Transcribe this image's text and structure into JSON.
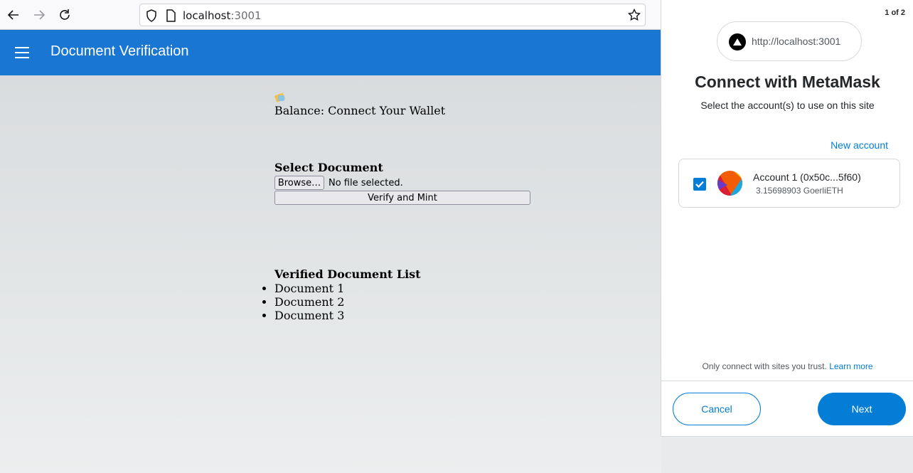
{
  "browser": {
    "url_host": "localhost",
    "url_port": ":3001",
    "icons": [
      "back-icon",
      "forward-icon",
      "reload-icon",
      "shield-icon",
      "page-icon",
      "bookmark-star-icon"
    ]
  },
  "app": {
    "title": "Document Verification",
    "brand_color": "#1976d2"
  },
  "main": {
    "balance_text": "Balance: Connect Your Wallet",
    "select_heading": "Select Document",
    "browse_label": "Browse…",
    "no_file_text": "No file selected.",
    "verify_label": "Verify and Mint",
    "list_heading": "Verified Document List",
    "documents": [
      "Document 1",
      "Document 2",
      "Document 3"
    ]
  },
  "metamask": {
    "page_indicator": "1 of 2",
    "site_url": "http://localhost:3001",
    "title": "Connect with MetaMask",
    "subtitle": "Select the account(s) to use on this site",
    "new_account_label": "New account",
    "account": {
      "name": "Account 1 (0x50c...5f60)",
      "balance": "3.15698903 GoerliETH",
      "checked": true
    },
    "trust_text": "Only connect with sites you trust.",
    "learn_more_label": "Learn more",
    "cancel_label": "Cancel",
    "next_label": "Next",
    "accent_color": "#037dd6"
  }
}
